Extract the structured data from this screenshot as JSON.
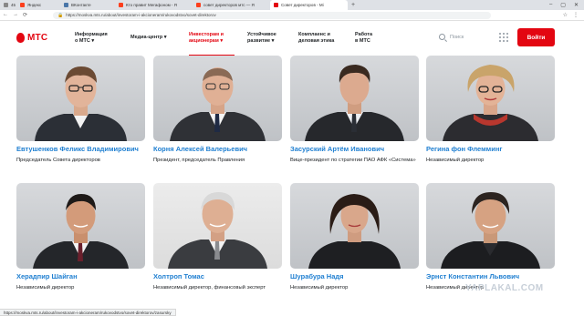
{
  "browser": {
    "tabs": [
      {
        "label": "45",
        "color": "#888888"
      },
      {
        "label": "Яндекс",
        "color": "#fc3f1d"
      },
      {
        "label": "ВКонтакте",
        "color": "#4a76a8"
      },
      {
        "label": "Кто правит Мегафоном - Я",
        "color": "#fc3f1d"
      },
      {
        "label": "совет директоров мтс — Я",
        "color": "#fc3f1d"
      },
      {
        "label": "Совет директоров - Mi",
        "color": "#e30611"
      }
    ],
    "active_tab_index": 5,
    "url": "https://moskva.mts.ru/about/investoram-i-akcioneram/rukovodstvo/sovet-direktorov"
  },
  "site": {
    "logo_text": "МТС",
    "nav": [
      {
        "line1": "Информация",
        "line2": "о МТС ▾"
      },
      {
        "line1": "Медиа-центр ▾",
        "line2": ""
      },
      {
        "line1": "Инвесторам и",
        "line2": "акционерам ▾"
      },
      {
        "line1": "Устойчивое",
        "line2": "развитие ▾"
      },
      {
        "line1": "Комплаенс и",
        "line2": "деловая этика"
      },
      {
        "line1": "Работа",
        "line2": "в МТС"
      }
    ],
    "search_label": "Поиск",
    "login_label": "Войти"
  },
  "directors": [
    {
      "name": "Евтушенков Феликс Владимирович",
      "role": "Председатель Совета директоров"
    },
    {
      "name": "Корня Алексей Валерьевич",
      "role": "Президент, председатель Правления"
    },
    {
      "name": "Засурский Артём Иванович",
      "role": "Вице-президент по стратегии ПАО АФК «Система»"
    },
    {
      "name": "Регина фон Флемминг",
      "role": "Независимый директор"
    },
    {
      "name": "Херадпир Шайган",
      "role": "Независимый директор"
    },
    {
      "name": "Холтроп Томас",
      "role": "Независимый директор, финансовый эксперт"
    },
    {
      "name": "Шурабура Надя",
      "role": "Независимый директор"
    },
    {
      "name": "Эрнст Константин Львович",
      "role": "Независимый директор"
    }
  ],
  "status_url": "https://moskva.mts.ru/about/investoram-i-akcioneram/rukovodstvo/sovet-direktorov/zasursky",
  "watermark": "YAPLAKAL.COM"
}
